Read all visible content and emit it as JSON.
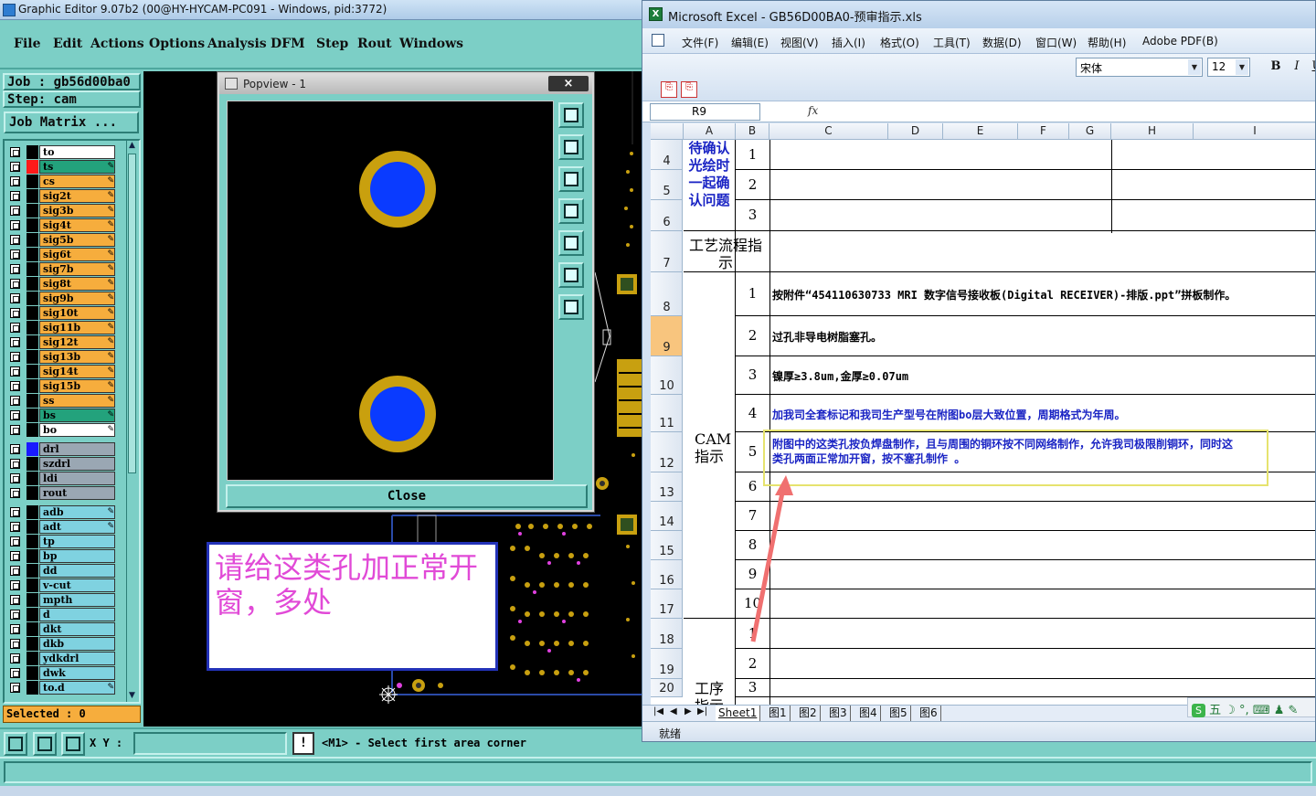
{
  "genesis": {
    "title": "Graphic Editor 9.07b2 (00@HY-HYCAM-PC091 - Windows, pid:3772)",
    "menu": [
      "File",
      "Edit",
      "Actions",
      "Options",
      "Analysis",
      "DFM",
      "Step",
      "Rout",
      "Windows"
    ],
    "job_line": "Job : gb56d00ba0",
    "step_line": "Step: cam",
    "job_matrix_label": "Job Matrix ...",
    "layers": [
      {
        "name": "to",
        "color": "#ffffff",
        "swatch": "#000000"
      },
      {
        "name": "ts",
        "color": "#23a27c",
        "swatch": "#ff1a1a",
        "active": true
      },
      {
        "name": "cs",
        "color": "#f6ad3d",
        "swatch": "#000000"
      },
      {
        "name": "sig2t",
        "color": "#f6ad3d",
        "swatch": "#000000"
      },
      {
        "name": "sig3b",
        "color": "#f6ad3d",
        "swatch": "#000000"
      },
      {
        "name": "sig4t",
        "color": "#f6ad3d",
        "swatch": "#000000"
      },
      {
        "name": "sig5b",
        "color": "#f6ad3d",
        "swatch": "#000000"
      },
      {
        "name": "sig6t",
        "color": "#f6ad3d",
        "swatch": "#000000"
      },
      {
        "name": "sig7b",
        "color": "#f6ad3d",
        "swatch": "#000000"
      },
      {
        "name": "sig8t",
        "color": "#f6ad3d",
        "swatch": "#000000"
      },
      {
        "name": "sig9b",
        "color": "#f6ad3d",
        "swatch": "#000000"
      },
      {
        "name": "sig10t",
        "color": "#f6ad3d",
        "swatch": "#000000"
      },
      {
        "name": "sig11b",
        "color": "#f6ad3d",
        "swatch": "#000000"
      },
      {
        "name": "sig12t",
        "color": "#f6ad3d",
        "swatch": "#000000"
      },
      {
        "name": "sig13b",
        "color": "#f6ad3d",
        "swatch": "#000000"
      },
      {
        "name": "sig14t",
        "color": "#f6ad3d",
        "swatch": "#000000"
      },
      {
        "name": "sig15b",
        "color": "#f6ad3d",
        "swatch": "#000000"
      },
      {
        "name": "ss",
        "color": "#f6ad3d",
        "swatch": "#000000"
      },
      {
        "name": "bs",
        "color": "#23a27c",
        "swatch": "#000000"
      },
      {
        "name": "bo",
        "color": "#ffffff",
        "swatch": "#000000"
      },
      {
        "name": "drl",
        "color": "#9aa7b3",
        "swatch": "#1a1aff",
        "gap": true
      },
      {
        "name": "szdrl",
        "color": "#9aa7b3",
        "swatch": "#000000"
      },
      {
        "name": "ldi",
        "color": "#9aa7b3",
        "swatch": "#000000"
      },
      {
        "name": "rout",
        "color": "#9aa7b3",
        "swatch": "#000000"
      },
      {
        "name": "adb",
        "color": "#7fd2e0",
        "swatch": "#000000",
        "gap": true
      },
      {
        "name": "adt",
        "color": "#7fd2e0",
        "swatch": "#000000"
      },
      {
        "name": "tp",
        "color": "#7fd2e0",
        "swatch": "#000000"
      },
      {
        "name": "bp",
        "color": "#7fd2e0",
        "swatch": "#000000"
      },
      {
        "name": "dd",
        "color": "#7fd2e0",
        "swatch": "#000000"
      },
      {
        "name": "v-cut",
        "color": "#7fd2e0",
        "swatch": "#000000"
      },
      {
        "name": "mpth",
        "color": "#7fd2e0",
        "swatch": "#000000"
      },
      {
        "name": "d",
        "color": "#7fd2e0",
        "swatch": "#000000"
      },
      {
        "name": "dkt",
        "color": "#7fd2e0",
        "swatch": "#000000"
      },
      {
        "name": "dkb",
        "color": "#7fd2e0",
        "swatch": "#000000"
      },
      {
        "name": "ydkdrl",
        "color": "#7fd2e0",
        "swatch": "#000000"
      },
      {
        "name": "dwk",
        "color": "#7fd2e0",
        "swatch": "#000000"
      },
      {
        "name": "to.d",
        "color": "#7fd2e0",
        "swatch": "#000000"
      }
    ],
    "selected_label": "Selected : 0",
    "popview": {
      "title": "Popview - 1",
      "close_x": "×",
      "close_button": "Close"
    },
    "comment_text": "请给这类孔加正常开窗，多处",
    "xy_label": "X Y :",
    "xy_value": "",
    "msg_bang": "!",
    "message": "<M1> - Select first area corner"
  },
  "excel": {
    "title": "Microsoft Excel - GB56D00BA0-预审指示.xls",
    "menu": [
      "文件(F)",
      "编辑(E)",
      "视图(V)",
      "插入(I)",
      "格式(O)",
      "工具(T)",
      "数据(D)",
      "窗口(W)",
      "帮助(H)",
      "Adobe PDF(B)"
    ],
    "font_name": "宋体",
    "font_size": "12",
    "name_box": "R9",
    "fx_label": "fx",
    "columns": [
      "A",
      "B",
      "C",
      "D",
      "E",
      "F",
      "G",
      "H",
      "I"
    ],
    "rows": [
      {
        "num": "4",
        "b": "1"
      },
      {
        "num": "5",
        "b": "2"
      },
      {
        "num": "6",
        "b": "3"
      },
      {
        "num": "7",
        "b": ""
      },
      {
        "num": "8",
        "b": "1",
        "c": "按附件“454110630733 MRI 数字信号接收板(Digital RECEIVER)-排版.ppt”拼板制作。"
      },
      {
        "num": "9",
        "b": "2",
        "c": "过孔非导电树脂塞孔。"
      },
      {
        "num": "10",
        "b": "3",
        "c": "镍厚≥3.8um,金厚≥0.07um"
      },
      {
        "num": "11",
        "b": "4",
        "c": "加我司全套标记和我司生产型号在附图bo层大致位置，周期格式为年周。"
      },
      {
        "num": "12",
        "b": "5",
        "c1": "附图中的这类孔按负焊盘制作，且与周围的铜环按不同网络制作，允许我司极限削铜环，同时这",
        "c2": "类孔两面正常加开窗，按不塞孔制作 。"
      },
      {
        "num": "13",
        "b": "6"
      },
      {
        "num": "14",
        "b": "7"
      },
      {
        "num": "15",
        "b": "8"
      },
      {
        "num": "16",
        "b": "9"
      },
      {
        "num": "17",
        "b": "10"
      },
      {
        "num": "18",
        "b": "1"
      },
      {
        "num": "19",
        "b": "2"
      },
      {
        "num": "20",
        "b": "3"
      }
    ],
    "section_a1": "待确认光绘时一起确认问题",
    "section_a2": "工艺流程指示",
    "section_a3": "CAM指示",
    "section_a4": "工序指示",
    "sheet_tabs": [
      "Sheet1",
      "图1",
      "图2",
      "图3",
      "图4",
      "图5",
      "图6"
    ],
    "ime_text": "五 ☽ °, ⌨ ♟ ✎",
    "status": "就绪"
  }
}
